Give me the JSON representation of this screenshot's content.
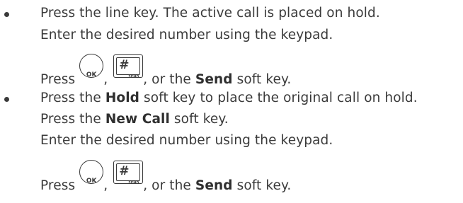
{
  "section_a": {
    "line1": "Press the line key. The active call is placed on hold.",
    "line2": "Enter the desired number using the keypad.",
    "press_word": "Press",
    "ok_key_label": "OK",
    "send_key_hash": "#",
    "send_key_label": "SEND",
    "comma": ",",
    "or_the": ", or the",
    "send_bold": "Send",
    "soft_key_tail": "soft key."
  },
  "section_b": {
    "line1_pre": "Press the",
    "hold_bold": "Hold",
    "line1_post": "soft key to place the original call on hold.",
    "line2_pre": "Press the",
    "new_call_bold": "New Call",
    "line2_post": "soft key.",
    "line3": "Enter the desired number using the keypad.",
    "press_word": "Press",
    "ok_key_label": "OK",
    "send_key_hash": "#",
    "send_key_label": "SEND",
    "comma": ",",
    "or_the": ", or the",
    "send_bold": "Send",
    "soft_key_tail": "soft key."
  }
}
